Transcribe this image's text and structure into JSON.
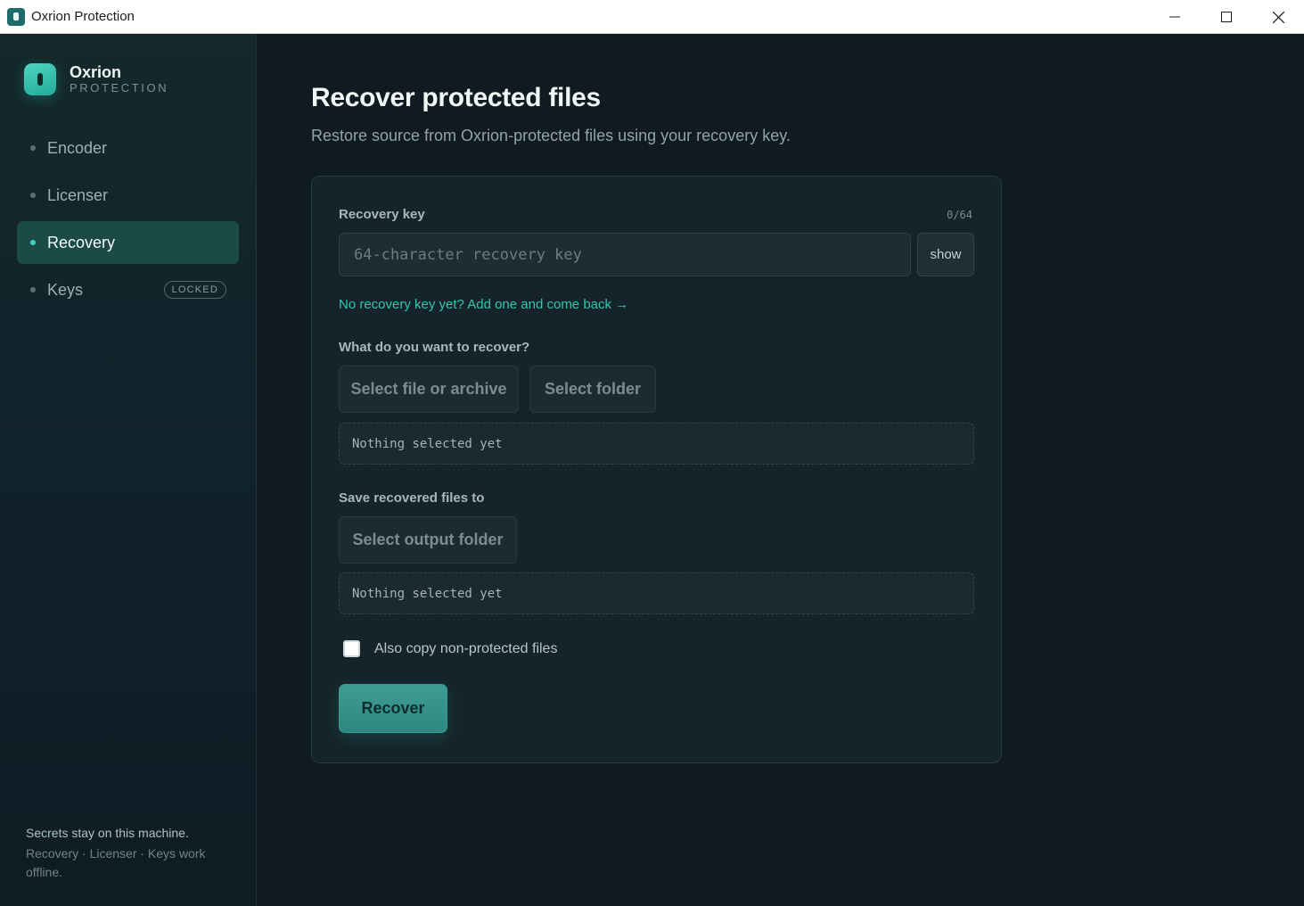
{
  "window": {
    "title": "Oxrion Protection"
  },
  "sidebar": {
    "brand_name": "Oxrion",
    "brand_sub": "PROTECTION",
    "items": [
      {
        "label": "Encoder"
      },
      {
        "label": "Licenser"
      },
      {
        "label": "Recovery",
        "active": true
      },
      {
        "label": "Keys",
        "badge": "LOCKED"
      }
    ],
    "footer_line1": "Secrets stay on this machine.",
    "footer_line2": "Recovery · Licenser · Keys work offline."
  },
  "main": {
    "title": "Recover protected files",
    "subtitle": "Restore source from Oxrion-protected files using your recovery key.",
    "recovery_key": {
      "label": "Recovery key",
      "counter": "0/64",
      "placeholder": "64-character recovery key",
      "value": "",
      "show_label": "show",
      "help_link": "No recovery key yet? Add one and come back →"
    },
    "source": {
      "label": "What do you want to recover?",
      "file_button": "Select file or archive",
      "folder_button": "Select folder",
      "selection": "Nothing selected yet"
    },
    "output": {
      "label": "Save recovered files to",
      "folder_button": "Select output folder",
      "selection": "Nothing selected yet"
    },
    "copy_option": {
      "label": "Also copy non-protected files",
      "checked": false
    },
    "recover_button": "Recover"
  },
  "colors": {
    "accent": "#2fc7b0",
    "active_nav": "#1c4a46",
    "background": "#0f1b20",
    "card": "#15242a"
  }
}
